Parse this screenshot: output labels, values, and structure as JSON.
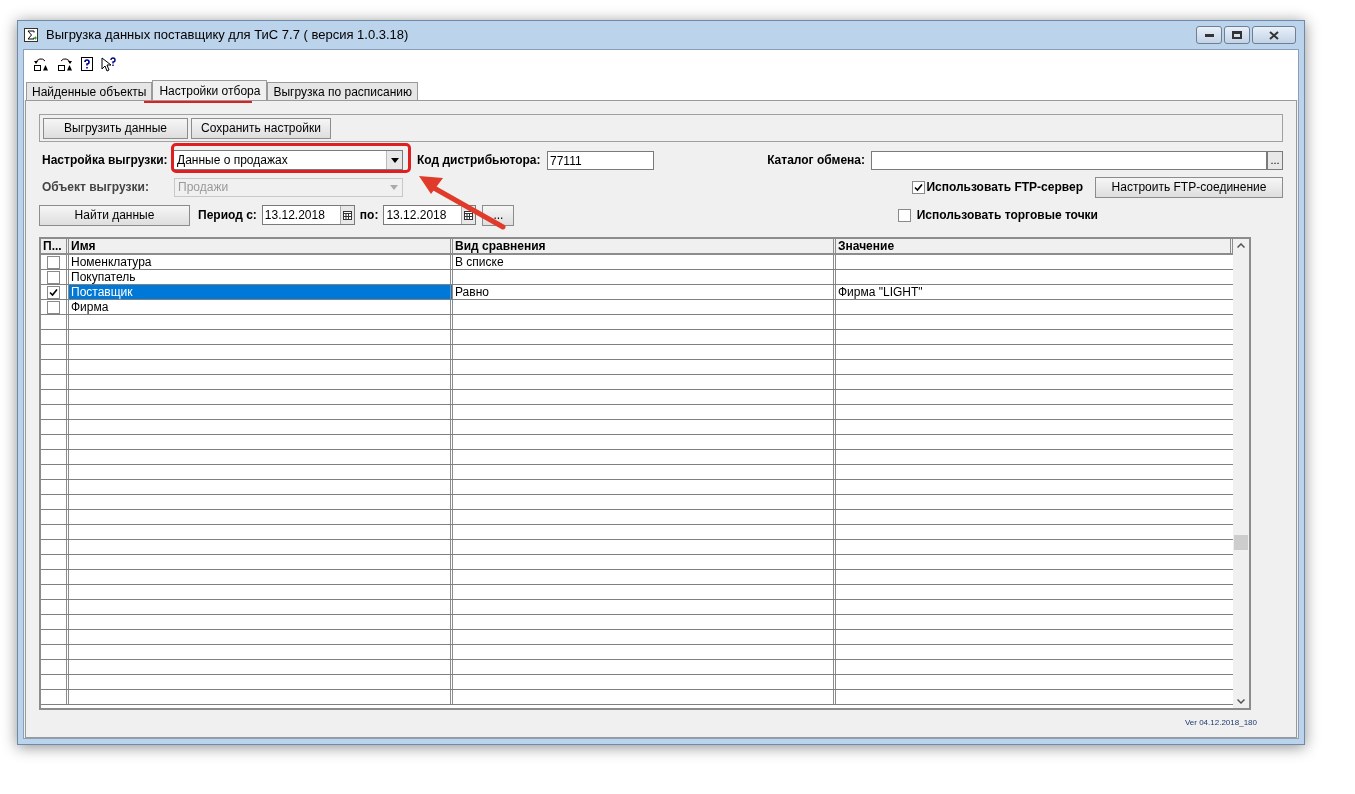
{
  "window": {
    "title": "Выгрузка данных поставщику для ТиС 7.7 ( версия 1.0.3.18)"
  },
  "tabs": [
    {
      "label": "Найденные объекты",
      "selected": false
    },
    {
      "label": "Настройки отбора",
      "selected": true
    },
    {
      "label": "Выгрузка по расписанию",
      "selected": false
    }
  ],
  "actions": [
    "Выгрузить данные",
    "Сохранить настройки"
  ],
  "export_setting": {
    "label": "Настройка выгрузки:",
    "value": "Данные о продажах"
  },
  "export_object": {
    "label": "Объект выгрузки:",
    "value": "Продажи",
    "disabled": true
  },
  "distributor_code": {
    "label": "Код дистрибьютора:",
    "value": "77111"
  },
  "exchange_catalog": {
    "label": "Каталог обмена:",
    "browse": "..."
  },
  "use_ftp": {
    "label": "Использовать FTP-сервер",
    "checked": true
  },
  "ftp_button": "Настроить FTP-соединение",
  "use_outlets": {
    "label": "Использовать торговые точки",
    "checked": false
  },
  "find_button": "Найти данные",
  "period": {
    "from_label": "Период с:",
    "from": "13.12.2018",
    "to_label": "по:",
    "to": "13.12.2018",
    "more": "..."
  },
  "table": {
    "columns": [
      "П...",
      "Имя",
      "Вид сравнения",
      "Значение"
    ],
    "rows": [
      {
        "checked": false,
        "selected": false,
        "name": "Номенклатура",
        "comparison": "В списке"
      },
      {
        "checked": false,
        "selected": false,
        "name": "Покупатель"
      },
      {
        "checked": true,
        "selected": true,
        "name": "Поставщик",
        "comparison": "Равно",
        "value": "Фирма \"LIGHT\""
      },
      {
        "checked": false,
        "selected": false,
        "name": "Фирма"
      }
    ]
  },
  "version": "Ver 04.12.2018_180"
}
